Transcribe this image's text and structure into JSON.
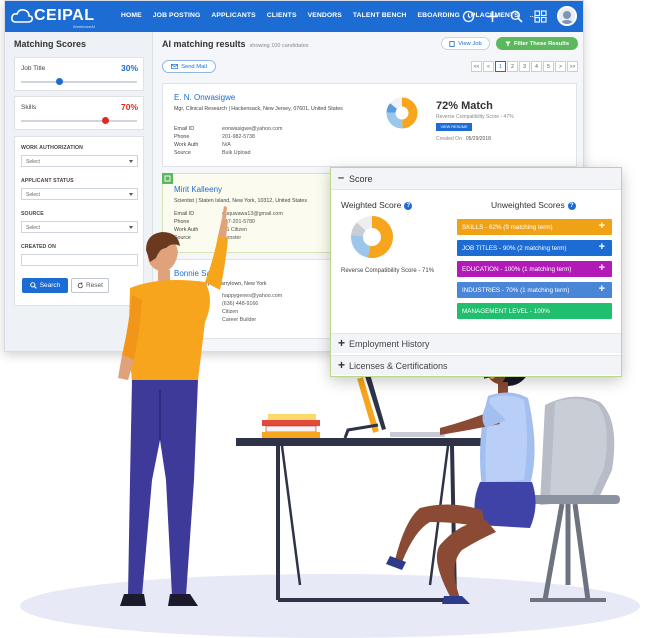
{
  "brand": {
    "name": "CEIPAL",
    "tagline": "WorkforceAI"
  },
  "nav": {
    "items": [
      "HOME",
      "JOB POSTING",
      "APPLICANTS",
      "CLIENTS",
      "VENDORS",
      "TALENT BENCH",
      "EBOARDING",
      "PLACEMENTS",
      "..."
    ],
    "icons": [
      "history-icon",
      "plus-icon",
      "search-icon",
      "grid-icon",
      "avatar"
    ]
  },
  "sidebar": {
    "title": "Matching Scores",
    "job_title": {
      "label": "Job Title",
      "value": "30%",
      "level": 0.33
    },
    "skills": {
      "label": "Skills",
      "value": "70%",
      "level": 0.73
    },
    "work_authorization": {
      "label": "WORK AUTHORIZATION",
      "value": "Select"
    },
    "applicant_status": {
      "label": "APPLICANT STATUS",
      "value": "Select"
    },
    "source": {
      "label": "SOURCE",
      "value": "Select"
    },
    "created_on": {
      "label": "CREATED ON",
      "value": ""
    },
    "search_label": "Search",
    "reset_label": "Reset"
  },
  "main": {
    "title": "AI matching results",
    "count": "showing 100 candidates",
    "view_job": "View Job",
    "filter_results": "Filter These Results",
    "send_mail": "Send Mail",
    "pager": [
      "<<",
      "<",
      "1",
      "2",
      "3",
      "4",
      "5",
      ">",
      ">>"
    ]
  },
  "candidates": [
    {
      "name": "E. N. Onwasigwe",
      "title": "Mgr, Clinical Research | Hackensack, New Jersey, 07601, United States",
      "email_label": "Email ID",
      "email": "eonwasigwe@yahoo.com",
      "phone_label": "Phone",
      "phone": "201-982-5738",
      "auth_label": "Work Auth",
      "auth": "N/A",
      "source_label": "Source",
      "source": "Bulk Upload",
      "match": "72% Match",
      "reverse": "Reverse Compatibility Score - 47%",
      "view_resume": "VIEW RESUME",
      "created_label": "Created On",
      "created": "05/29/2018"
    },
    {
      "name": "Mirit Kalleeny",
      "title": "Scientist | Staten Island, New York, 10312, United States",
      "email_label": "Email ID",
      "email": "ququwawa13@gmail.com",
      "phone_label": "Phone",
      "phone": "717-201-5780",
      "auth_label": "Work Auth",
      "auth": "US Citizen",
      "source_label": "Source",
      "source": "Monster"
    },
    {
      "name": "Bonnie Saez",
      "title": "Business Analyst | Tarrytown, New York",
      "email_label": "Email ID",
      "email": "happygenes@yahoo.com",
      "phone_label": "Phone",
      "phone": "(636) 448-9166",
      "auth_label": "Work Auth",
      "auth": "Citizen",
      "source_label": "Source",
      "source": "Career Builder"
    }
  ],
  "score_panel": {
    "title": "Score",
    "weighted_title": "Weighted Score",
    "unweighted_title": "Unweighted Scores",
    "reverse": "Reverse Compatibility Score - 71%",
    "bars": [
      {
        "label": "SKILLS - 62% (9 matching term)",
        "color": "#f0a216"
      },
      {
        "label": "JOB TITLES - 90% (2 matching term)",
        "color": "#1c6cd4"
      },
      {
        "label": "EDUCATION - 100% (1 matching term)",
        "color": "#b21ab8"
      },
      {
        "label": "INDUSTRIES - 70% (1 matching term)",
        "color": "#4a86d8"
      },
      {
        "label": "MANAGEMENT LEVEL - 100%",
        "color": "#1fbf6d"
      }
    ],
    "sections": [
      "Employment History",
      "Licenses & Certifications"
    ]
  },
  "colors": {
    "brand_blue": "#1c6cd4",
    "accent_orange": "#f7a51c",
    "skills_red": "#e0281e",
    "filter_green": "#5cb85c"
  }
}
